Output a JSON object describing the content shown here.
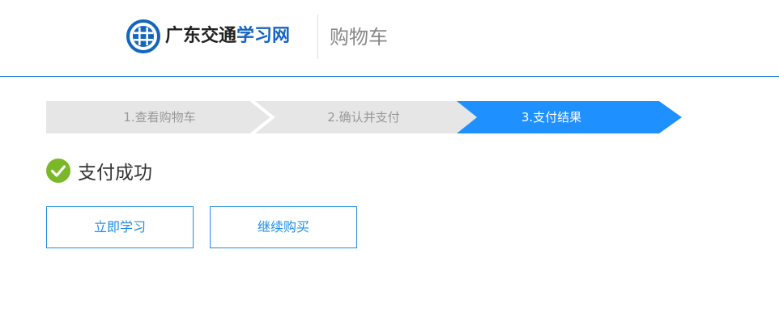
{
  "header": {
    "logo_text_dark": "广东交通",
    "logo_text_blue": "学习网",
    "logo_icon": "guangdong-transport-logo-icon",
    "page_title": "购物车"
  },
  "steps": [
    {
      "label": "1.查看购物车",
      "active": false
    },
    {
      "label": "2.确认并支付",
      "active": false
    },
    {
      "label": "3.支付结果",
      "active": true
    }
  ],
  "result": {
    "icon": "check-circle-icon",
    "message": "支付成功"
  },
  "actions": {
    "study_label": "立即学习",
    "continue_label": "继续购买"
  },
  "colors": {
    "accent": "#1f8ee6",
    "step_inactive": "#e6e6e6",
    "step_active": "#1e90ff",
    "success": "#7ab829",
    "logo_blue": "#1565c0"
  }
}
